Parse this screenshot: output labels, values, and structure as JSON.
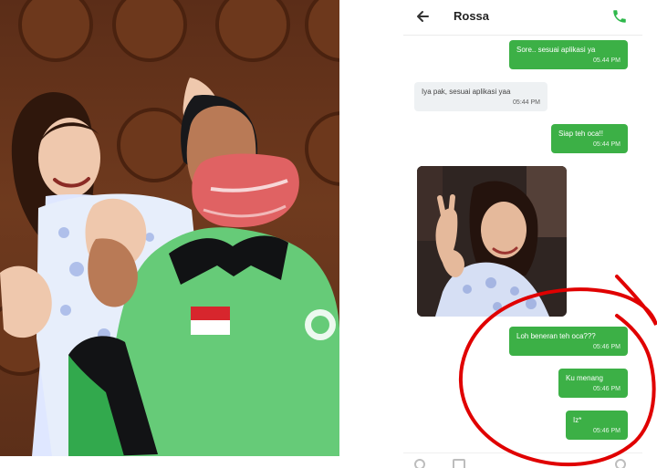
{
  "chat": {
    "contact_name": "Rossa",
    "messages": [
      {
        "direction": "outgoing",
        "text": "Sore.. sesuai aplikasi ya",
        "time": "05.44 PM"
      },
      {
        "direction": "incoming",
        "text": "Iya pak, sesuai aplikasi yaa",
        "time": "05:44 PM"
      },
      {
        "direction": "outgoing",
        "text": "Siap teh oca!!",
        "time": "05:44 PM"
      },
      {
        "direction": "outgoing",
        "text": "Loh beneran teh oca???",
        "time": "05:46 PM"
      },
      {
        "direction": "outgoing",
        "text": "Ku menang",
        "time": "05:46 PM"
      },
      {
        "direction": "outgoing",
        "text": "Iz*",
        "time": "05:46 PM"
      }
    ]
  },
  "icons": {
    "back": "arrow-left-icon",
    "call": "phone-icon"
  },
  "colors": {
    "outgoing_bubble": "#3cb046",
    "incoming_bubble": "#eef1f3",
    "annotation": "#e00000"
  }
}
